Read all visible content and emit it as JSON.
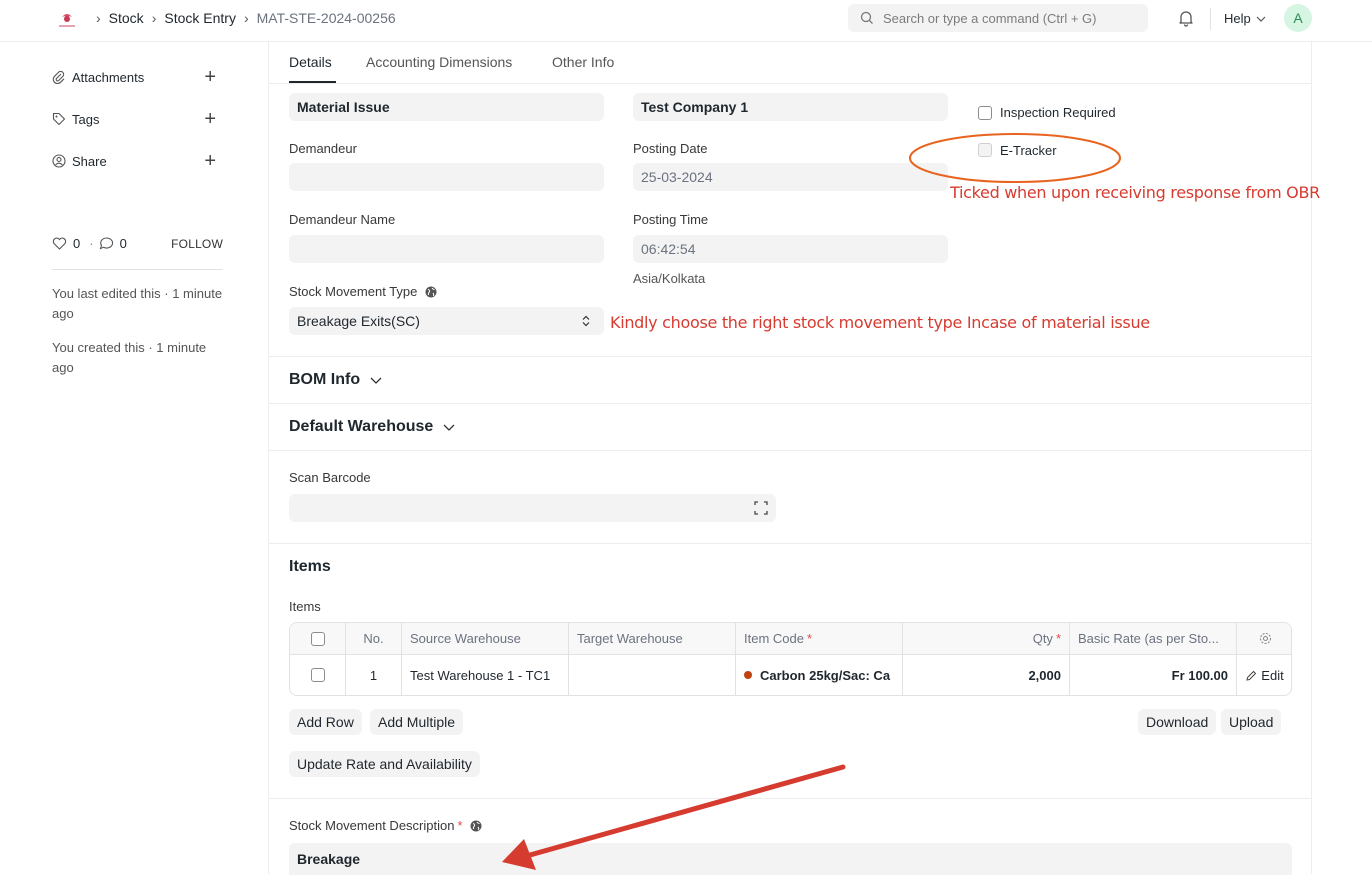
{
  "breadcrumb": {
    "items": [
      "Stock",
      "Stock Entry"
    ],
    "current": "MAT-STE-2024-00256"
  },
  "search": {
    "placeholder": "Search or type a command (Ctrl + G)"
  },
  "navbar": {
    "help_label": "Help",
    "avatar_initial": "A"
  },
  "sidebar": {
    "items": [
      {
        "label": "Attachments",
        "icon": "paperclip-icon"
      },
      {
        "label": "Tags",
        "icon": "tag-icon"
      },
      {
        "label": "Share",
        "icon": "share-user-icon"
      }
    ],
    "likes": "0",
    "comments": "0",
    "follow_label": "FOLLOW",
    "activity": [
      "You last edited this · 1 minute ago",
      "You created this · 1 minute ago"
    ]
  },
  "tabs": [
    "Details",
    "Accounting Dimensions",
    "Other Info"
  ],
  "form": {
    "purpose_value": "Material Issue",
    "company_value": "Test Company 1",
    "inspection_label": "Inspection Required",
    "etracker_label": "E-Tracker",
    "demandeur_label": "Demandeur",
    "demandeur_value": "",
    "posting_date_label": "Posting Date",
    "posting_date_value": "25-03-2024",
    "demandeur_name_label": "Demandeur Name",
    "demandeur_name_value": "",
    "posting_time_label": "Posting Time",
    "posting_time_value": "06:42:54",
    "timezone": "Asia/Kolkata",
    "stock_movement_type_label": "Stock Movement Type",
    "stock_movement_type_value": "Breakage Exits(SC)",
    "bom_info_title": "BOM Info",
    "default_warehouse_title": "Default Warehouse",
    "scan_barcode_label": "Scan Barcode",
    "items_title": "Items",
    "items_label": "Items",
    "stock_movement_description_label": "Stock Movement Description",
    "stock_movement_description_value": "Breakage"
  },
  "annotations": {
    "etracker_note": "Ticked when upon receiving response from OBR",
    "movement_type_note": "Kindly choose the right stock movement type Incase of material issue",
    "accent_color": "#d63b2f"
  },
  "items_table": {
    "columns": [
      "No.",
      "Source Warehouse",
      "Target Warehouse",
      "Item Code",
      "Qty",
      "Basic Rate (as per Sto..."
    ],
    "rows": [
      {
        "no": "1",
        "source": "Test Warehouse 1 - TC1",
        "target": "",
        "item_code": "Carbon 25kg/Sac: Ca",
        "qty": "2,000",
        "rate": "Fr 100.00",
        "edit": "Edit"
      }
    ]
  },
  "buttons": {
    "add_row": "Add Row",
    "add_multiple": "Add Multiple",
    "download": "Download",
    "upload": "Upload",
    "update_rate": "Update Rate and Availability"
  }
}
